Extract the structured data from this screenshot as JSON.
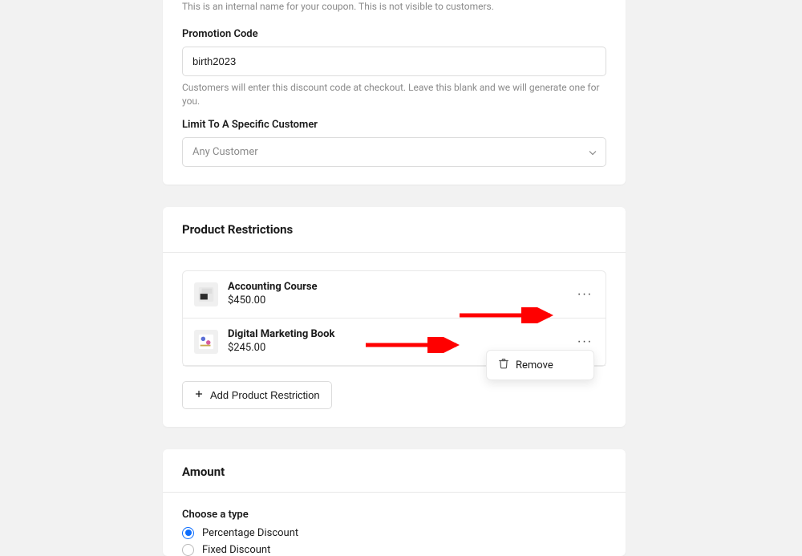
{
  "topSection": {
    "internalNameHelper": "This is an internal name for your coupon. This is not visible to customers.",
    "promoCodeLabel": "Promotion Code",
    "promoCodeValue": "birth2023",
    "promoCodeHelper": "Customers will enter this discount code at checkout. Leave this blank and we will generate one for you.",
    "limitCustomerLabel": "Limit To A Specific Customer",
    "limitCustomerPlaceholder": "Any Customer"
  },
  "productRestrictions": {
    "title": "Product Restrictions",
    "items": [
      {
        "name": "Accounting Course",
        "price": "$450.00"
      },
      {
        "name": "Digital Marketing Book",
        "price": "$245.00"
      }
    ],
    "removeLabel": "Remove",
    "addButtonLabel": "Add Product Restriction"
  },
  "amountSection": {
    "title": "Amount",
    "chooseTypeLabel": "Choose a type",
    "options": [
      {
        "label": "Percentage Discount",
        "selected": true
      },
      {
        "label": "Fixed Discount",
        "selected": false
      }
    ]
  }
}
